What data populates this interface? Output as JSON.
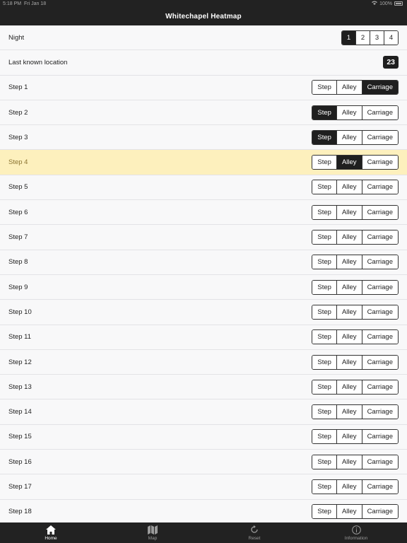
{
  "status_bar": {
    "time": "5:18 PM",
    "date": "Fri Jan 18",
    "battery": "100%"
  },
  "nav": {
    "title": "Whitechapel Heatmap"
  },
  "night": {
    "label": "Night",
    "options": [
      "1",
      "2",
      "3",
      "4"
    ],
    "selected": "1"
  },
  "last_known": {
    "label": "Last known location",
    "value": "23"
  },
  "steps": [
    {
      "label": "Step 1",
      "selected": "Carriage"
    },
    {
      "label": "Step 2",
      "selected": "Step"
    },
    {
      "label": "Step 3",
      "selected": "Step"
    },
    {
      "label": "Step 4",
      "selected": "Alley",
      "highlight": true
    },
    {
      "label": "Step 5",
      "selected": ""
    },
    {
      "label": "Step 6",
      "selected": ""
    },
    {
      "label": "Step 7",
      "selected": ""
    },
    {
      "label": "Step 8",
      "selected": ""
    },
    {
      "label": "Step 9",
      "selected": ""
    },
    {
      "label": "Step 10",
      "selected": ""
    },
    {
      "label": "Step 11",
      "selected": ""
    },
    {
      "label": "Step 12",
      "selected": ""
    },
    {
      "label": "Step 13",
      "selected": ""
    },
    {
      "label": "Step 14",
      "selected": ""
    },
    {
      "label": "Step 15",
      "selected": ""
    },
    {
      "label": "Step 16",
      "selected": ""
    },
    {
      "label": "Step 17",
      "selected": ""
    },
    {
      "label": "Step 18",
      "selected": ""
    }
  ],
  "move_options": [
    "Step",
    "Alley",
    "Carriage"
  ],
  "tabs": [
    {
      "label": "Home",
      "icon": "home-icon",
      "active": true
    },
    {
      "label": "Map",
      "icon": "map-icon",
      "active": false
    },
    {
      "label": "Reset",
      "icon": "reset-icon",
      "active": false
    },
    {
      "label": "Information",
      "icon": "info-icon",
      "active": false
    }
  ]
}
